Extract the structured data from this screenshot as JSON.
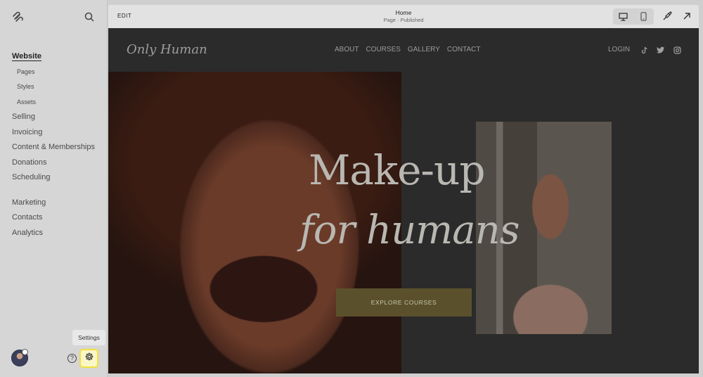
{
  "sidebar": {
    "active": "Website",
    "subitems": [
      "Pages",
      "Styles",
      "Assets"
    ],
    "group1": [
      "Selling",
      "Invoicing",
      "Content & Memberships",
      "Donations",
      "Scheduling"
    ],
    "group2": [
      "Marketing",
      "Contacts",
      "Analytics"
    ],
    "help_label": "?",
    "settings_tooltip": "Settings"
  },
  "topbar": {
    "edit_label": "EDIT",
    "page_title": "Home",
    "page_status": "Page · Published"
  },
  "site": {
    "name": "Only Human",
    "nav": [
      "ABOUT",
      "COURSES",
      "GALLERY",
      "CONTACT"
    ],
    "login": "LOGIN",
    "headline_1": "Make-up",
    "headline_2": "for humans",
    "cta": "EXPLORE COURSES"
  },
  "icons": {
    "logo": "squarespace-logo-icon",
    "search": "search-icon",
    "desktop": "desktop-icon",
    "mobile": "mobile-icon",
    "design": "paintbrush-icon",
    "exit": "arrow-up-right-icon",
    "tiktok": "tiktok-icon",
    "twitter": "twitter-icon",
    "instagram": "instagram-icon",
    "settings": "gear-icon"
  },
  "colors": {
    "cta_bg": "#5a512c",
    "settings_highlight": "#f0e23c"
  }
}
